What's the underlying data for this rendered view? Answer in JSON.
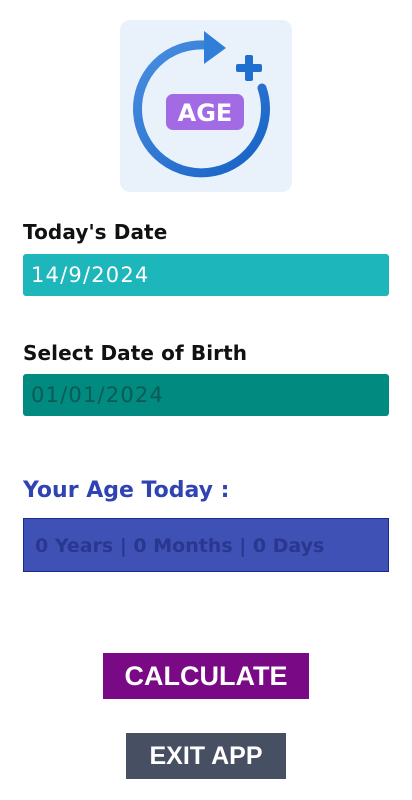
{
  "logo": {
    "icon": "age-refresh-icon",
    "text": "AGE",
    "colors": {
      "ring": "#1e6fd0",
      "badge": "#a36be3",
      "plus": "#1e6fd0",
      "background": "#e9f2fb"
    }
  },
  "today": {
    "label": "Today's Date",
    "value": "14/9/2024"
  },
  "dob": {
    "label": "Select Date of Birth",
    "placeholder": "01/01/2024"
  },
  "result": {
    "heading": "Your Age Today :",
    "text": "0 Years | 0 Months | 0 Days"
  },
  "buttons": {
    "calculate": "CALCULATE",
    "exit": "EXIT APP"
  },
  "colors": {
    "today_field": "#1db6ba",
    "dob_field": "#008a80",
    "age_heading": "#2f44b2",
    "age_box": "#3f51b5",
    "calculate_button": "#7a0985",
    "exit_button": "#475063"
  }
}
